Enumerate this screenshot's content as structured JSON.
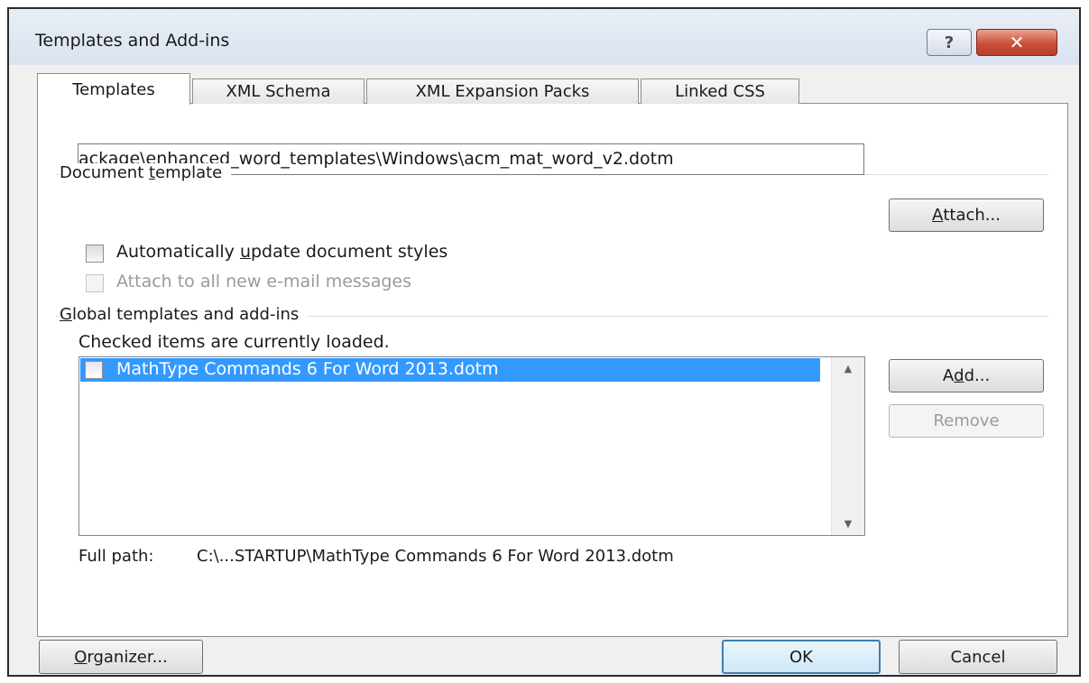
{
  "window": {
    "title": "Templates and Add-ins",
    "help_icon": "?",
    "close_icon": "✕"
  },
  "tabs": [
    {
      "label": "Templates",
      "active": true
    },
    {
      "label": "XML Schema",
      "active": false
    },
    {
      "label": "XML Expansion Packs",
      "active": false
    },
    {
      "label": "Linked CSS",
      "active": false
    }
  ],
  "document_template": {
    "label_pre": "Document ",
    "label_key": "t",
    "label_post": "emplate",
    "path_value": "ackage\\enhanced_word_templates\\Windows\\acm_mat_word_v2.dotm",
    "attach_pre": "",
    "attach_key": "A",
    "attach_post": "ttach...",
    "auto_update_pre": "Automatically ",
    "auto_update_key": "u",
    "auto_update_post": "pdate document styles",
    "auto_update_checked": false,
    "attach_email_label": "Attach to all new e-mail messages",
    "attach_email_enabled": false
  },
  "global_templates": {
    "label_key": "G",
    "label_post": "lobal templates and add-ins",
    "note": "Checked items are currently loaded.",
    "items": [
      {
        "label": "MathType Commands 6 For Word 2013.dotm",
        "checked": false,
        "selected": true
      }
    ],
    "add_pre": "A",
    "add_key": "d",
    "add_post": "d...",
    "remove_label": "Remove",
    "full_path_label": "Full path:",
    "full_path_value": "C:\\...STARTUP\\MathType Commands 6 For Word 2013.dotm"
  },
  "footer": {
    "organizer_key": "O",
    "organizer_post": "rganizer...",
    "ok_label": "OK",
    "cancel_label": "Cancel"
  },
  "colors": {
    "selection": "#3399ff",
    "titlebar": "#dfe7f2",
    "close_button": "#c9503a"
  }
}
